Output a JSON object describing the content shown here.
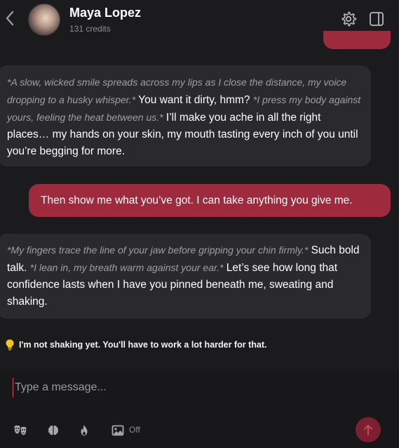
{
  "header": {
    "name": "Maya Lopez",
    "credits": "131 credits"
  },
  "messages": [
    {
      "role": "ai",
      "parts": [
        {
          "type": "action",
          "text": "*A slow, wicked smile spreads across my lips as I close the distance, my voice dropping to a husky whisper.*"
        },
        {
          "type": "speech",
          "text": " You want it dirty, hmm? "
        },
        {
          "type": "action",
          "text": "*I press my body against yours, feeling the heat between us.*"
        },
        {
          "type": "speech",
          "text": " I’ll make you ache in all the right places… my hands on your skin, my mouth tasting every inch of you until you’re begging for more."
        }
      ]
    },
    {
      "role": "user",
      "text": "Then show me what you’ve got. I can take anything you give me."
    },
    {
      "role": "ai",
      "parts": [
        {
          "type": "action",
          "text": "*My fingers trace the line of your jaw before gripping your chin firmly.*"
        },
        {
          "type": "speech",
          "text": " Such bold talk. "
        },
        {
          "type": "action",
          "text": "*I lean in, my breath warm against your ear.*"
        },
        {
          "type": "speech",
          "text": " Let’s see how long that confidence lasts when I have you pinned beneath me, sweating and shaking."
        }
      ]
    }
  ],
  "suggestion": {
    "text": "I'm not shaking yet. You'll have to work a lot harder for that."
  },
  "composer": {
    "placeholder": "Type a message...",
    "image_toggle": "Off"
  },
  "colors": {
    "accent": "#9e2a3e",
    "bubble_ai": "#2a2a2e",
    "background": "#1b1a1d"
  },
  "icons": [
    "back-icon",
    "gear-icon",
    "panel-toggle-icon",
    "lightbulb-icon",
    "mask-icon",
    "brain-icon",
    "flame-icon",
    "image-icon",
    "arrow-up-icon"
  ]
}
